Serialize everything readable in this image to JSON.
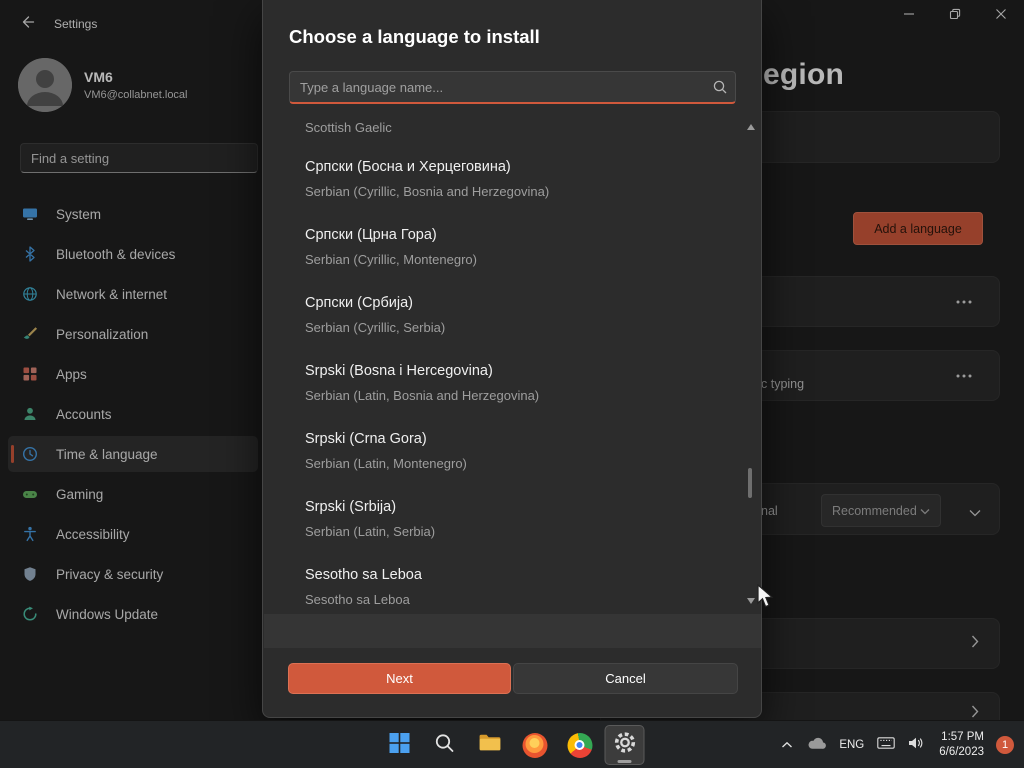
{
  "colors": {
    "accent": "#d0593c",
    "window_bg": "#202020",
    "dialog_bg": "#2c2c2c"
  },
  "titlebar": {
    "title": "Settings"
  },
  "profile": {
    "name": "VM6",
    "email": "VM6@collabnet.local"
  },
  "sidebar": {
    "search_placeholder": "Find a setting",
    "selected_index": 6,
    "items": [
      {
        "label": "System"
      },
      {
        "label": "Bluetooth & devices"
      },
      {
        "label": "Network & internet"
      },
      {
        "label": "Personalization"
      },
      {
        "label": "Apps"
      },
      {
        "label": "Accounts"
      },
      {
        "label": "Time & language"
      },
      {
        "label": "Gaming"
      },
      {
        "label": "Accessibility"
      },
      {
        "label": "Privacy & security"
      },
      {
        "label": "Windows Update"
      }
    ]
  },
  "page": {
    "heading_partial": "egion",
    "add_language_label": "Add a language",
    "typing_partial": "c typing",
    "regional_partial": "nal",
    "recommended_label": "Recommended"
  },
  "dialog": {
    "title": "Choose a language to install",
    "search_placeholder": "Type a language name...",
    "partial_top_item": "Scottish Gaelic",
    "languages": [
      {
        "primary": "Српски (Босна и Херцеговина)",
        "secondary": "Serbian (Cyrillic, Bosnia and Herzegovina)"
      },
      {
        "primary": "Српски (Црна Гора)",
        "secondary": "Serbian (Cyrillic, Montenegro)"
      },
      {
        "primary": "Српски (Србија)",
        "secondary": "Serbian (Cyrillic, Serbia)"
      },
      {
        "primary": "Srpski (Bosna i Hercegovina)",
        "secondary": "Serbian (Latin, Bosnia and Herzegovina)"
      },
      {
        "primary": "Srpski (Crna Gora)",
        "secondary": "Serbian (Latin, Montenegro)"
      },
      {
        "primary": "Srpski (Srbija)",
        "secondary": "Serbian (Latin, Serbia)"
      },
      {
        "primary": "Sesotho sa Leboa",
        "secondary": "Sesotho sa Leboa"
      }
    ],
    "buttons": {
      "next": "Next",
      "cancel": "Cancel"
    }
  },
  "taskbar": {
    "tray": {
      "language": "ENG",
      "time": "1:57 PM",
      "date": "6/6/2023",
      "notification_count": "1"
    }
  }
}
